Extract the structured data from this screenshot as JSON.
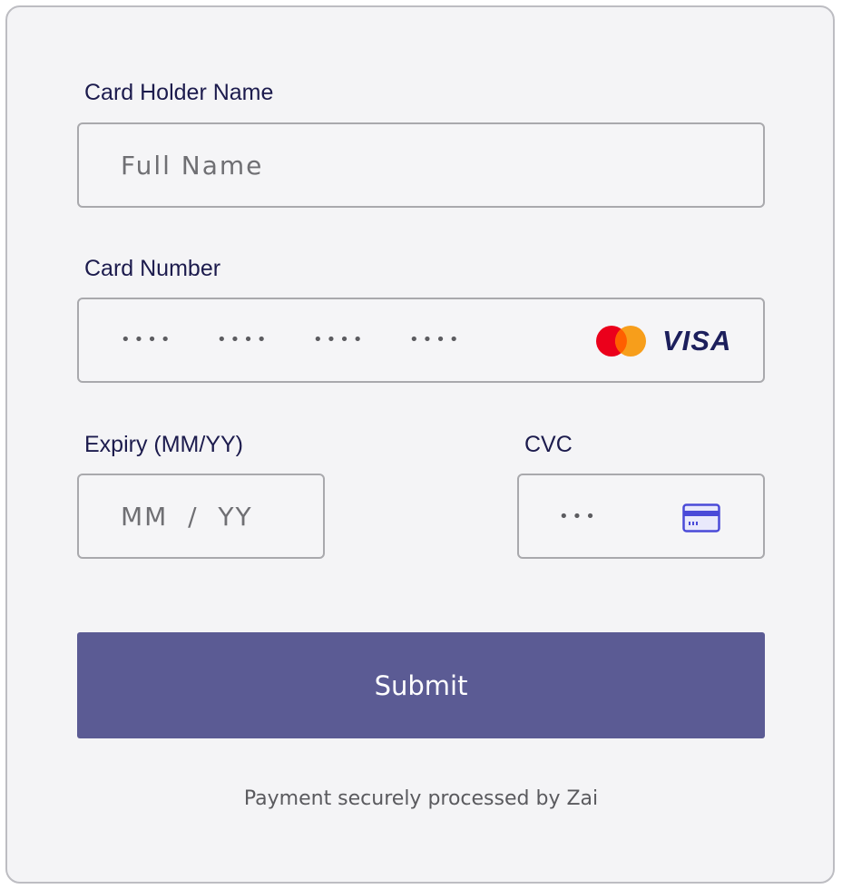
{
  "form": {
    "card_holder": {
      "label": "Card Holder Name",
      "placeholder": "Full Name"
    },
    "card_number": {
      "label": "Card Number",
      "groups": [
        "••••",
        "••••",
        "••••",
        "••••"
      ],
      "brands": [
        "mastercard-logo",
        "visa-logo"
      ],
      "visa_text": "VISA"
    },
    "expiry": {
      "label": "Expiry (MM/YY)",
      "placeholder": "MM  /  YY"
    },
    "cvc": {
      "label": "CVC",
      "placeholder": "•••",
      "icon": "card-back-icon"
    },
    "submit_label": "Submit",
    "footer_text": "Payment securely processed by Zai"
  },
  "colors": {
    "accent": "#5b5b94",
    "label": "#1c1b4d",
    "mastercard_red": "#eb001b",
    "mastercard_orange": "#f79e1b",
    "visa_navy": "#1c1f5c"
  }
}
